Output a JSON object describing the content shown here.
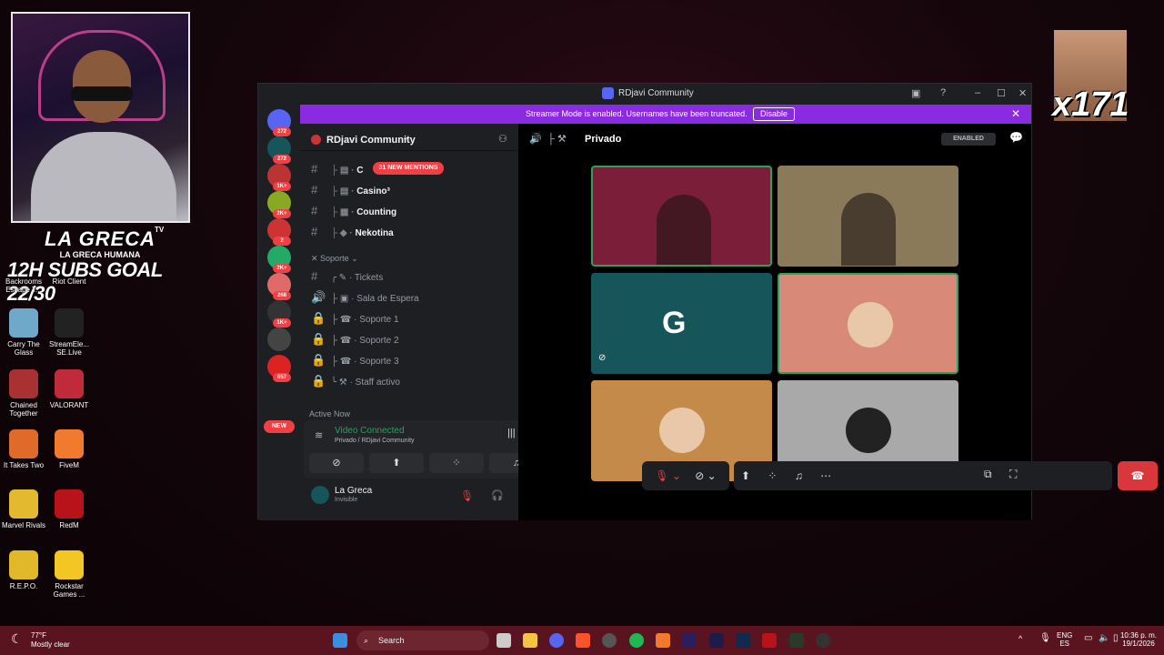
{
  "overlay": {
    "brand": "LA GRECA",
    "brand_tag": "TV",
    "brand_sub": "LA GRECA HUMANA",
    "subs_goal": "12H SUBS GOAL 22/30",
    "meme_count": "x171"
  },
  "desktop_icons": [
    {
      "label": "Backrooms Escape T...",
      "icon": "backrooms-icon",
      "color": "#2a2a2a"
    },
    {
      "label": "Riot Client",
      "icon": "riot-client-icon",
      "color": "#d13639"
    },
    {
      "label": "Carry The Glass",
      "icon": "carry-the-glass-icon",
      "color": "#6fa8c8"
    },
    {
      "label": "StreamEle... SE.Live",
      "icon": "streamelements-icon",
      "color": "#222"
    },
    {
      "label": "Chained Together",
      "icon": "chained-together-icon",
      "color": "#a83232"
    },
    {
      "label": "VALORANT",
      "icon": "valorant-icon",
      "color": "#c02a3a"
    },
    {
      "label": "It Takes Two",
      "icon": "it-takes-two-icon",
      "color": "#e06a2a"
    },
    {
      "label": "FiveM",
      "icon": "fivem-icon",
      "color": "#f27a2e"
    },
    {
      "label": "Marvel Rivals",
      "icon": "marvel-rivals-icon",
      "color": "#e3b92e"
    },
    {
      "label": "RedM",
      "icon": "redm-icon",
      "color": "#b8121b"
    },
    {
      "label": "R.E.P.O.",
      "icon": "repo-icon",
      "color": "#e0b82a"
    },
    {
      "label": "Rockstar Games ...",
      "icon": "rockstar-icon",
      "color": "#f3c623"
    }
  ],
  "window": {
    "title": "RDjavi Community"
  },
  "banner": {
    "text": "Streamer Mode is enabled. Usernames have been truncated.",
    "button": "Disable"
  },
  "guilds": [
    {
      "badge": "272"
    },
    {
      "badge": "272"
    },
    {
      "badge": "1K+"
    },
    {
      "badge": "2K+"
    },
    {
      "badge": "2"
    },
    {
      "badge": "2K+"
    },
    {
      "badge": "268"
    },
    {
      "badge": "1K+"
    },
    {
      "badge": ""
    },
    {
      "badge": "657"
    }
  ],
  "guild_new": "NEW",
  "server": {
    "name": "RDjavi Community",
    "mentions": "31 NEW MENTIONS",
    "channels": [
      {
        "name": "C"
      },
      {
        "name": "Casino³"
      },
      {
        "name": "Counting"
      },
      {
        "name": "Nekotina"
      }
    ],
    "category": "Soporte",
    "support_channels": [
      {
        "name": "Tickets"
      },
      {
        "name": "Sala de Espera"
      },
      {
        "name": "Soporte 1"
      },
      {
        "name": "Soporte 2"
      },
      {
        "name": "Soporte 3"
      },
      {
        "name": "Staff activo"
      }
    ],
    "active_now": "Active Now"
  },
  "voice": {
    "status": "Video Connected",
    "location": "Privado / RDjavi Community"
  },
  "user": {
    "name": "La Greca",
    "status": "Invisible"
  },
  "call": {
    "channel": "Privado",
    "streamer_badge": "ENABLED",
    "tiles": [
      {
        "bg": "#7a1e3a",
        "kind": "video"
      },
      {
        "bg": "#8a7a5a",
        "kind": "video"
      },
      {
        "bg": "#16555a",
        "kind": "logo",
        "label": "G"
      },
      {
        "bg": "#d98978",
        "kind": "avatar"
      },
      {
        "bg": "#c48a4a",
        "kind": "avatar"
      },
      {
        "bg": "#a9a9a9",
        "kind": "avatar"
      }
    ]
  },
  "taskbar": {
    "temp": "77°F",
    "weather": "Mostly clear",
    "search": "Search",
    "lang_top": "ENG",
    "lang_bottom": "ES",
    "time": "10:36 p. m.",
    "date": "19/1/2026"
  }
}
